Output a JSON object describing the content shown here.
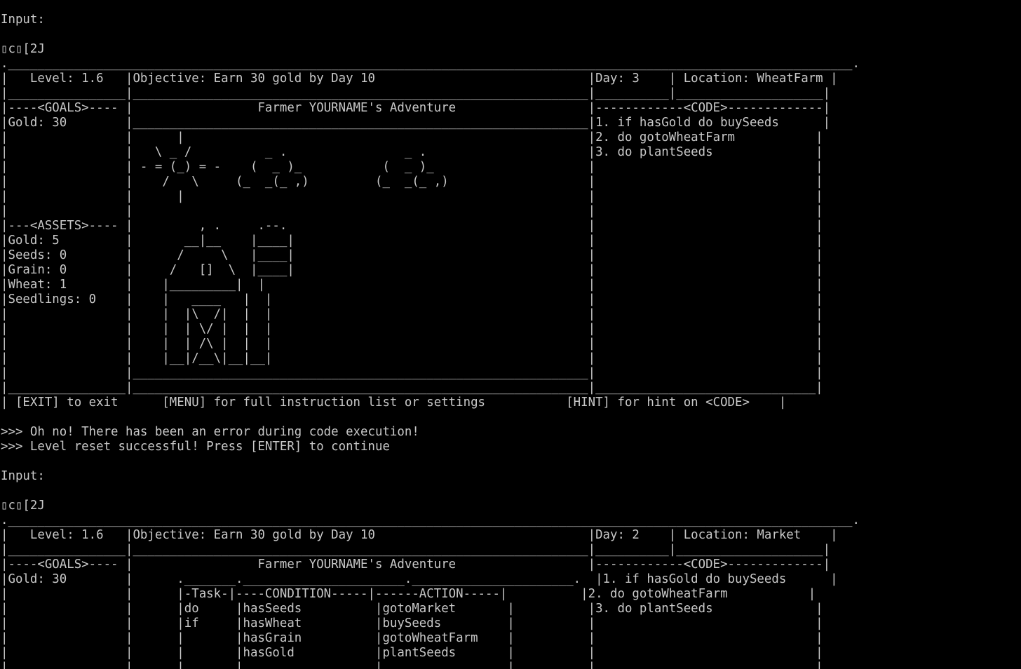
{
  "theme": {
    "background": "#000000",
    "foreground": "#c8c8c8"
  },
  "lines": [
    {
      "kind": "prompt",
      "text": "Input:"
    },
    {
      "kind": "blank",
      "text": ""
    },
    {
      "kind": "escape-sequence",
      "text": "▯c▯[2J"
    },
    {
      "kind": "border",
      "text": ".___________________________________________________________________________________________________________________."
    },
    {
      "kind": "header",
      "text": "|   Level: 1.6   |Objective: Earn 30 gold by Day 10                             |Day: 3    | Location: WheatFarm |"
    },
    {
      "kind": "frame",
      "text": "|________________|______________________________________________________________|__________|____________________|"
    },
    {
      "kind": "frame",
      "text": "|----<GOALS>---- |                 Farmer YOURNAME's Adventure                  |------------<CODE>-------------|"
    },
    {
      "kind": "frame",
      "text": "|Gold: 30        |______________________________________________________________|1. if hasGold do buySeeds      |"
    },
    {
      "kind": "art",
      "text": "|                |      |                                                       |2. do gotoWheatFarm           |"
    },
    {
      "kind": "art",
      "text": "|                |   \\ _ /          _ .                _ .                      |3. do plantSeeds              |"
    },
    {
      "kind": "art",
      "text": "|                | - = (_) = -    (  _ )_           (  _ )_                     |                              |"
    },
    {
      "kind": "art",
      "text": "|                |    /   \\     (_  _(_ ,)         (_  _(_ ,)                   |                              |"
    },
    {
      "kind": "art",
      "text": "|                |      |                                                       |                              |"
    },
    {
      "kind": "art",
      "text": "|                |                                                              |                              |"
    },
    {
      "kind": "art",
      "text": "|---<ASSETS>---- |         , .     .--.                                         |                              |"
    },
    {
      "kind": "art",
      "text": "|Gold: 5         |       __|__    |____|                                        |                              |"
    },
    {
      "kind": "art",
      "text": "|Seeds: 0        |      /     \\   |____|                                        |                              |"
    },
    {
      "kind": "art",
      "text": "|Grain: 0        |     /   []  \\  |____|                                        |                              |"
    },
    {
      "kind": "art",
      "text": "|Wheat: 1        |    |_________|  |                                            |                              |"
    },
    {
      "kind": "art",
      "text": "|Seedlings: 0    |    |   ____   |  |                                           |                              |"
    },
    {
      "kind": "art",
      "text": "|                |    |  |\\  /|  |  |                                           |                              |"
    },
    {
      "kind": "art",
      "text": "|                |    |  | \\/ |  |  |                                           |                              |"
    },
    {
      "kind": "art",
      "text": "|                |    |  | /\\ |  |  |                                           |                              |"
    },
    {
      "kind": "art",
      "text": "|                |    |__|/__\\|__|__|                                           |                              |"
    },
    {
      "kind": "frame",
      "text": "|                |______________________________________________________________|                              |"
    },
    {
      "kind": "frame",
      "text": "|________________|______________________________________________________________|______________________________|"
    },
    {
      "kind": "footer",
      "text": "| [EXIT] to exit      [MENU] for full instruction list or settings           [HINT] for hint on <CODE>    |"
    },
    {
      "kind": "blank",
      "text": ""
    },
    {
      "kind": "message",
      "text": ">>> Oh no! There has been an error during code execution!"
    },
    {
      "kind": "message",
      "text": ">>> Level reset successful! Press [ENTER] to continue"
    },
    {
      "kind": "blank",
      "text": ""
    },
    {
      "kind": "prompt",
      "text": "Input:"
    },
    {
      "kind": "blank",
      "text": ""
    },
    {
      "kind": "escape-sequence",
      "text": "▯c▯[2J"
    },
    {
      "kind": "border",
      "text": ".___________________________________________________________________________________________________________________."
    },
    {
      "kind": "header",
      "text": "|   Level: 1.6   |Objective: Earn 30 gold by Day 10                             |Day: 2    | Location: Market    |"
    },
    {
      "kind": "frame",
      "text": "|________________|______________________________________________________________|__________|____________________|"
    },
    {
      "kind": "frame",
      "text": "|----<GOALS>---- |                 Farmer YOURNAME's Adventure                  |------------<CODE>-------------|"
    },
    {
      "kind": "table",
      "text": "|Gold: 30        |      ._______.______________________.______________________.  |1. if hasGold do buySeeds      |"
    },
    {
      "kind": "table",
      "text": "|                |      |-Task-|----CONDITION-----|------ACTION-----|          |2. do gotoWheatFarm           |"
    },
    {
      "kind": "table",
      "text": "|                |      |do     |hasSeeds          |gotoMarket       |          |3. do plantSeeds              |"
    },
    {
      "kind": "table",
      "text": "|                |      |if     |hasWheat          |buySeeds         |          |                              |"
    },
    {
      "kind": "table",
      "text": "|                |      |       |hasGrain          |gotoWheatFarm    |          |                              |"
    },
    {
      "kind": "table",
      "text": "|                |      |       |hasGold           |plantSeeds       |          |                              |"
    },
    {
      "kind": "table",
      "text": "|                |      |       |                  |                 |          |                              |"
    }
  ]
}
